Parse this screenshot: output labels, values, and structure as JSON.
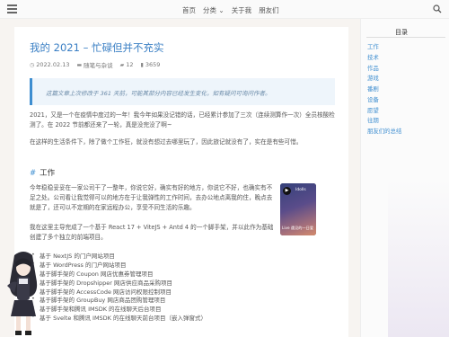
{
  "nav": {
    "items": [
      "首页",
      "分类",
      "关于我",
      "朋友们"
    ]
  },
  "post": {
    "title": "我的 2021 – 忙碌但并不充实",
    "meta": {
      "date": "2022.02.13",
      "category": "随笔与杂谈",
      "comments": "12",
      "views": "3659"
    },
    "notice": "这篇文章上次修改于 361 天前，可能其部分内容已经发生变化，如有疑问可询问作者。",
    "paragraphs": [
      "2021，又是一个在疫情中度过的一年！我今年如果没记错的话，已经累计参加了三次（连续测算作一次）全员核酸检测了。在 2022 节前都还来了一轮，真是没完没了啊~",
      "在这样的生活条件下，除了做个工作狂，就没有想过去哪里玩了，因此旅记就没有了，实在是有些可惜。"
    ],
    "section_title": "工作",
    "work_paragraphs": [
      "今年稳稳妥妥在一家公司干了一整年，你说它好，确实有好的地方，你说它不好，也确实有不足之处。公司看让我觉得可以的地方在于让我弹性的工作时间，去办公地点离我的住，晚点去就是了，还可以不定期的在家远程办公，享受不同生活的乐趣。",
      "我在这里主导完成了一个基于 React 17 + ViteJS + Antd 4 的一个脚手架，并以此作为基础创建了多个独立的前端项目。"
    ],
    "list": [
      "基于 NextJS 的门户网站项目",
      "基于 WordPress 的门户网站项目",
      "基于脚手架的 Coupon 网店优惠券管理项目",
      "基于脚手架的 Dropshipper 网店供应商品采购项目",
      "基于脚手架的 AccessCode 网店访问权限控制项目",
      "基于脚手架的 GroupBuy 网店商品团购管理项目",
      "基于脚手架和腾讯 IMSDK 的在线聊天后台项目",
      "基于 Svelte 和腾讯 IMSDK 的在线聊天前台项目（嵌入弹窗式）"
    ]
  },
  "player": {
    "logo": "Idolls",
    "caption": "Live 遇见的一日爱"
  },
  "toc": {
    "title": "目录",
    "items": [
      "工作",
      "技术",
      "作品",
      "游戏",
      "番剧",
      "设备",
      "愿望",
      "往期",
      "朋友们的总结"
    ]
  },
  "colors": {
    "link": "#3e8ed0",
    "title": "#3a7fc4",
    "background": "#f7f4f1"
  }
}
